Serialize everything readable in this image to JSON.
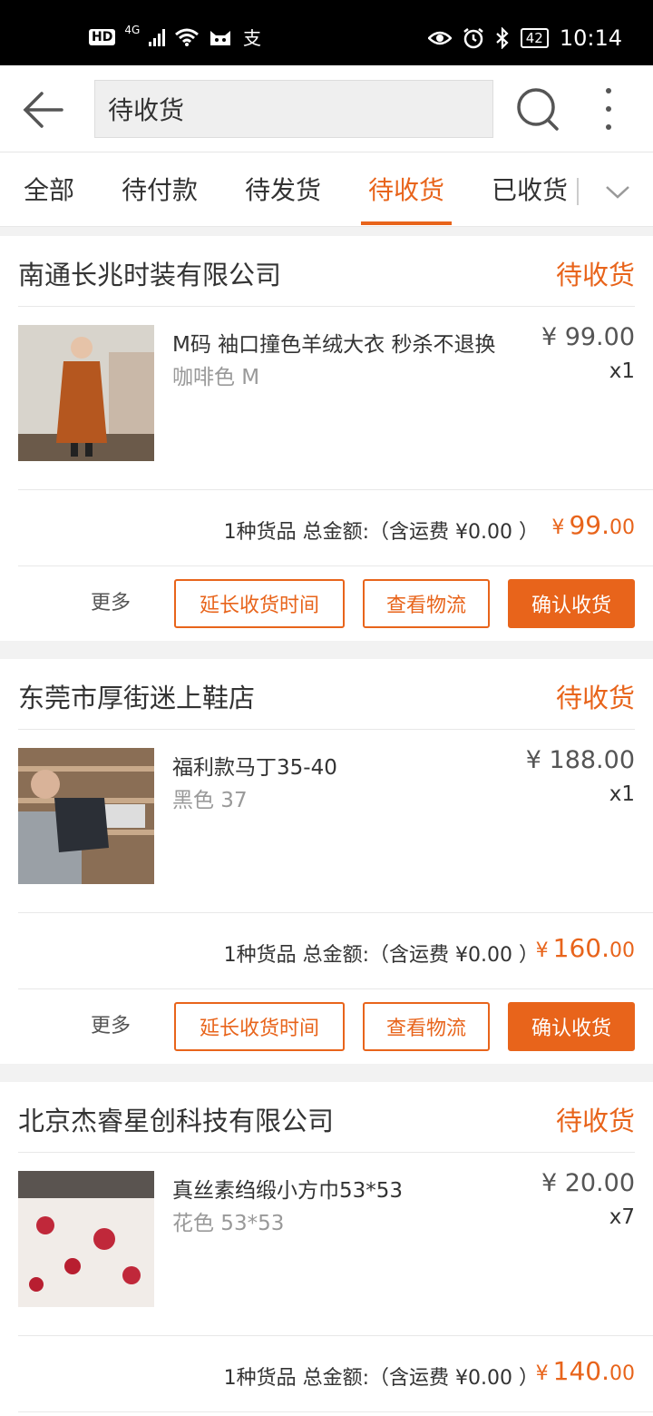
{
  "status_bar": {
    "hd": "HD",
    "network": "4G",
    "battery": "42",
    "time": "10:14",
    "icons": [
      "signal-icon",
      "wifi-icon",
      "cat-app-icon",
      "alipay-icon",
      "eye-icon",
      "alarm-icon",
      "bluetooth-icon",
      "battery-icon"
    ]
  },
  "header": {
    "search_value": "待收货",
    "icons": [
      "back-arrow-icon",
      "search-icon",
      "more-vertical-icon"
    ]
  },
  "tabs": [
    {
      "label": "全部",
      "active": false
    },
    {
      "label": "待付款",
      "active": false
    },
    {
      "label": "待发货",
      "active": false
    },
    {
      "label": "待收货",
      "active": true
    },
    {
      "label": "已收货",
      "active": false
    }
  ],
  "colors": {
    "accent": "#e8641b",
    "muted": "#999999"
  },
  "orders": [
    {
      "shop": "南通长兆时装有限公司",
      "status": "待收货",
      "item_title": "M码 袖口撞色羊绒大衣 秒杀不退换",
      "item_spec": "咖啡色 M",
      "item_price": "¥ 99.00",
      "item_qty": "x1",
      "summary": "1种货品 总金额:（含运费 ¥0.00 ）",
      "total_currency": "¥",
      "total_int": "99.",
      "total_dec": "00",
      "more_label": "更多",
      "buttons": [
        "延长收货时间",
        "查看物流",
        "确认收货"
      ]
    },
    {
      "shop": "东莞市厚街迷上鞋店",
      "status": "待收货",
      "item_title": "福利款马丁35-40",
      "item_spec": "黑色 37",
      "item_price": "¥ 188.00",
      "item_qty": "x1",
      "summary": "1种货品 总金额:（含运费 ¥0.00 ）",
      "total_currency": "¥",
      "total_int": "160.",
      "total_dec": "00",
      "more_label": "更多",
      "buttons": [
        "延长收货时间",
        "查看物流",
        "确认收货"
      ]
    },
    {
      "shop": "北京杰睿星创科技有限公司",
      "status": "待收货",
      "item_title": "真丝素绉缎小方巾53*53",
      "item_spec": "花色 53*53",
      "item_price": "¥ 20.00",
      "item_qty": "x7",
      "summary": "1种货品 总金额:（含运费 ¥0.00 ）",
      "total_currency": "¥",
      "total_int": "140.",
      "total_dec": "00"
    }
  ]
}
